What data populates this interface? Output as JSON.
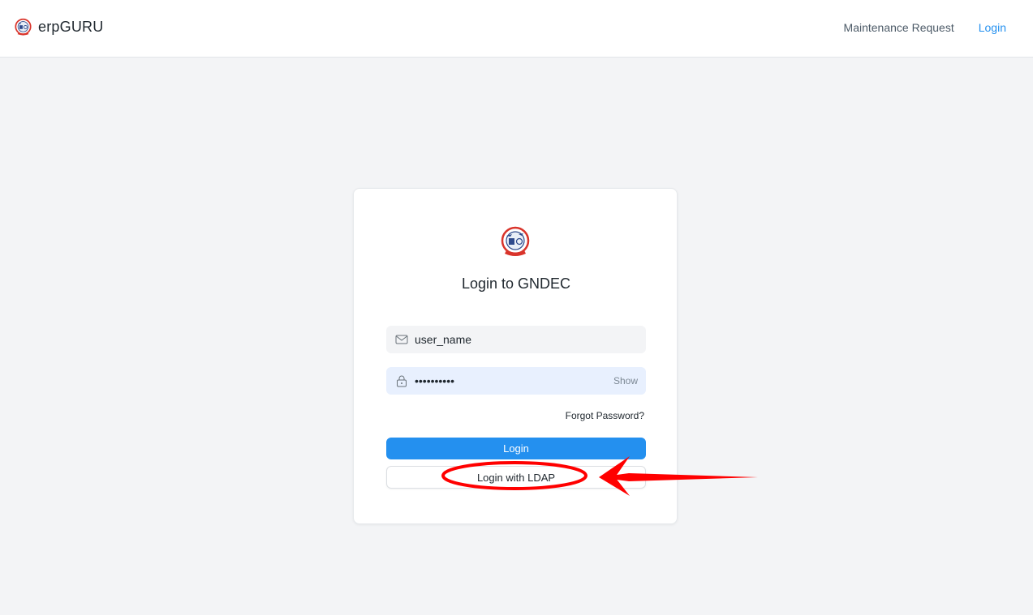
{
  "navbar": {
    "brand": "erpGURU",
    "links": [
      {
        "label": "Maintenance Request"
      },
      {
        "label": "Login"
      }
    ]
  },
  "login": {
    "title": "Login to GNDEC",
    "email": {
      "value": "user_name",
      "icon": "mail-icon"
    },
    "password": {
      "value": "••••••••••",
      "toggle_label": "Show",
      "icon": "lock-icon"
    },
    "forgot_label": "Forgot Password?",
    "login_label": "Login",
    "ldap_label": "Login with LDAP"
  },
  "colors": {
    "primary": "#2490ef",
    "background": "#f3f4f6",
    "annotation": "#ff0000"
  }
}
